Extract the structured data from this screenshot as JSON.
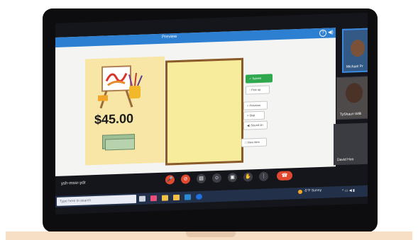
{
  "preview": {
    "title": "Preview",
    "help_glyph": "?",
    "sound_glyph": "◀)"
  },
  "card": {
    "price": "$45.00"
  },
  "buttons": {
    "submit": "✓ Submit",
    "pick_up": "↑ Pick up",
    "previous": "< Previous",
    "skip": "> Skip",
    "sound_on": "◀) Sound on",
    "view_item": "□ View item"
  },
  "participants": [
    {
      "name": "Michael Pr"
    },
    {
      "name": "TyShaun Willi"
    },
    {
      "name": "David Hoo"
    }
  ],
  "meeting": {
    "code": "ysh-mssr-ydr"
  },
  "controls": {
    "mic_glyph": "🎤",
    "cam_glyph": "⊘",
    "cc_glyph": "▤",
    "emoji_glyph": "☺",
    "present_glyph": "▣",
    "hand_glyph": "✋",
    "more_glyph": "⋮",
    "end_glyph": "☎"
  },
  "taskbar": {
    "search_placeholder": "Type here to search",
    "weather": "-5°F  Sunny"
  },
  "colors": {
    "accent": "#2c7fd1",
    "submit": "#2fa84f",
    "end_call": "#e0492f",
    "card": "#f8e6a6",
    "drop_zone": "#f7ec9c"
  }
}
